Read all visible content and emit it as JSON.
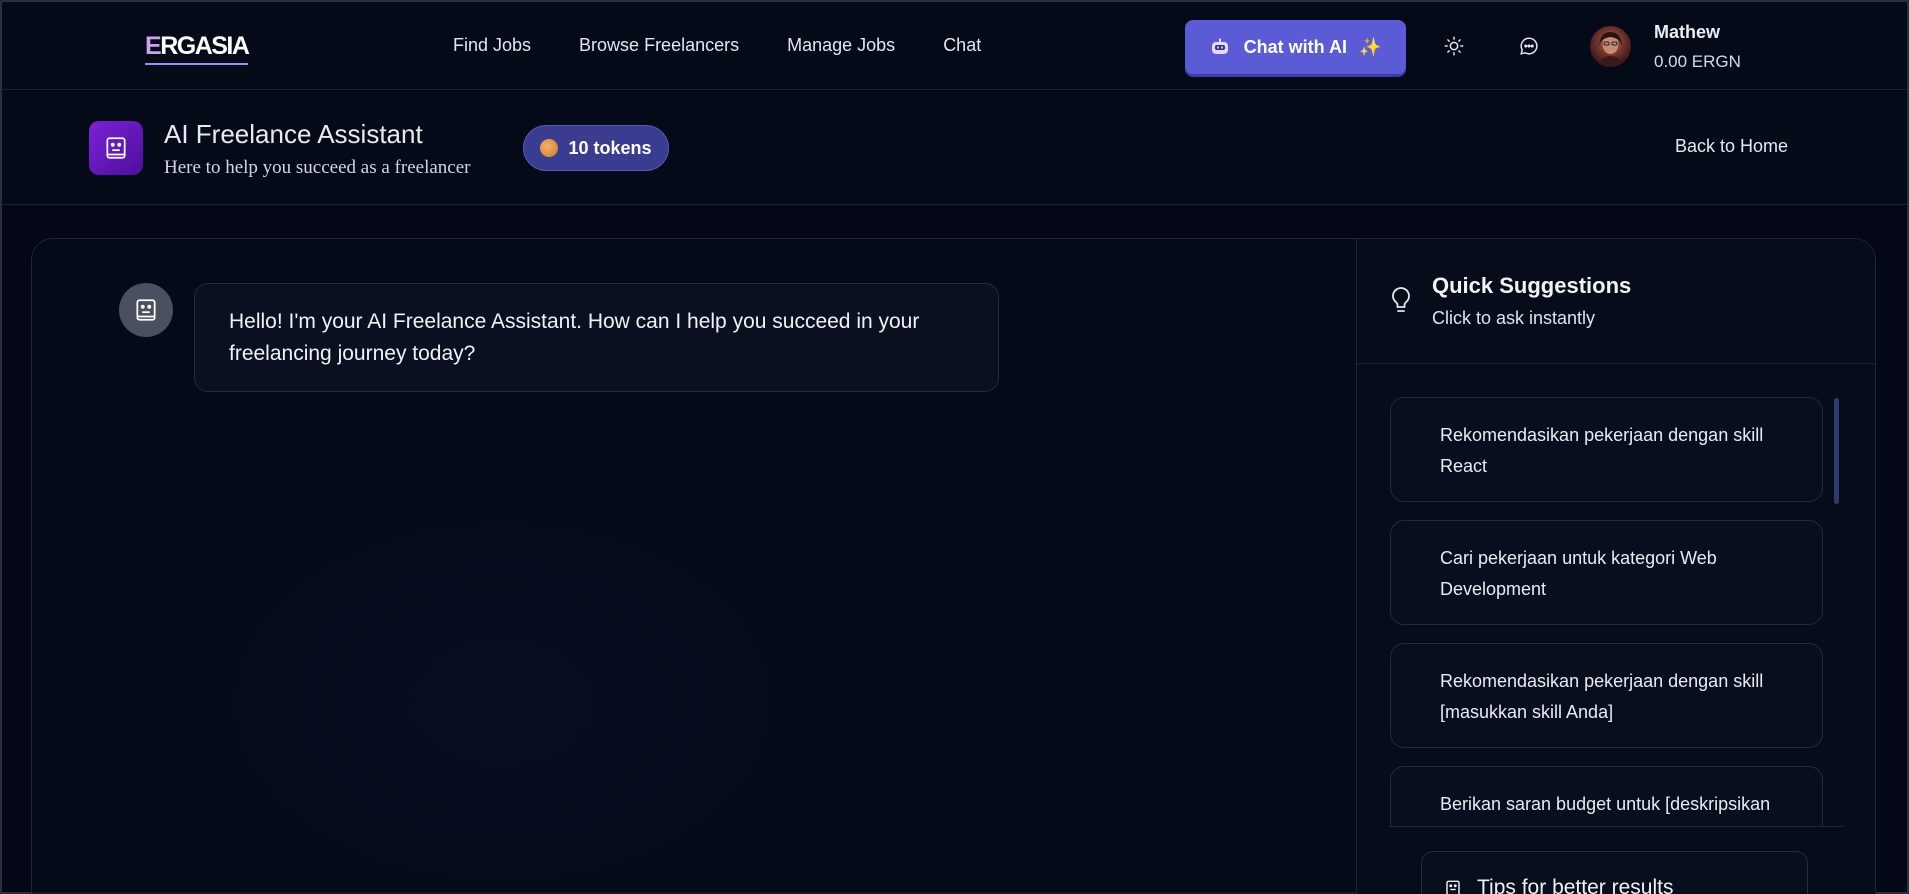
{
  "navbar": {
    "logo_first": "E",
    "logo_rest": "RGASIA",
    "links": [
      "Find Jobs",
      "Browse Freelancers",
      "Manage Jobs",
      "Chat"
    ],
    "ai_button_label": "Chat with AI",
    "ai_button_emoji": "✨",
    "user_name": "Mathew",
    "user_balance": "0.00 ERGN"
  },
  "header": {
    "title": "AI Freelance Assistant",
    "subtitle": "Here to help you succeed as a freelancer",
    "tokens": "10 tokens",
    "back_label": "Back to Home"
  },
  "chat": {
    "messages": [
      {
        "role": "assistant",
        "text": "Hello! I'm your AI Freelance Assistant. How can I help you succeed in your freelancing journey today?"
      }
    ]
  },
  "sidebar": {
    "title": "Quick Suggestions",
    "subtitle": "Click to ask instantly",
    "suggestions": [
      "Rekomendasikan pekerjaan dengan skill React",
      "Cari pekerjaan untuk kategori Web Development",
      "Rekomendasikan pekerjaan dengan skill [masukkan skill Anda]",
      "Berikan saran budget untuk [deskripsikan proyek Anda]"
    ],
    "tips_label": "Tips for better results"
  },
  "colors": {
    "accent": "#5b5bd6",
    "background": "#040816",
    "token_pill": "#3a3d8f",
    "assistant_icon": "#7c22d8"
  }
}
